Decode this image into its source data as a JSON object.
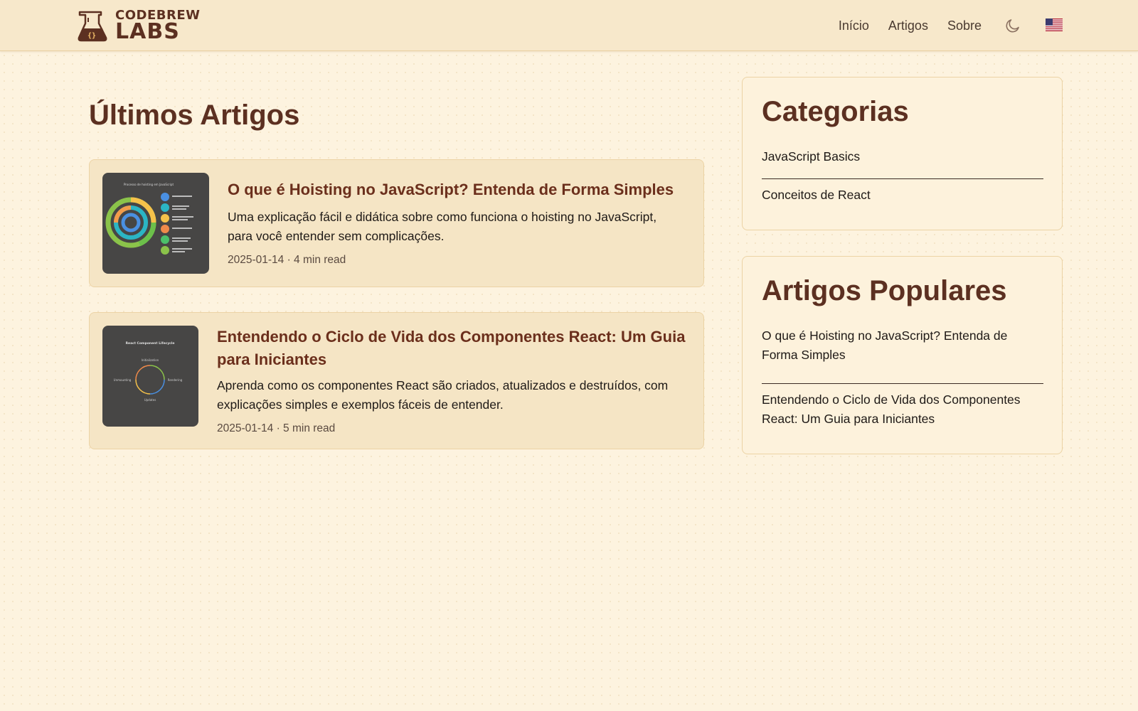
{
  "header": {
    "logo_top": "CODEBREW",
    "logo_bottom": "LABS",
    "nav": [
      "Início",
      "Artigos",
      "Sobre"
    ]
  },
  "main": {
    "title": "Últimos Artigos",
    "articles": [
      {
        "title": "O que é Hoisting no JavaScript? Entenda de Forma Simples",
        "description": "Uma explicação fácil e didática sobre como funciona o hoisting no JavaScript, para você entender sem complicações.",
        "meta": "2025-01-14 · 4 min read",
        "thumb_label": "Processo de hoisting em JavaScript"
      },
      {
        "title": "Entendendo o Ciclo de Vida dos Componentes React: Um Guia para Iniciantes",
        "description": "Aprenda como os componentes React são criados, atualizados e destruídos, com explicações simples e exemplos fáceis de entender.",
        "meta": "2025-01-14 · 5 min read",
        "thumb_label": "React Component Lifecycle",
        "thumb_stages": [
          "Initialization",
          "Rendering",
          "Updates",
          "Unmounting"
        ]
      }
    ]
  },
  "sidebar": {
    "categories_title": "Categorias",
    "categories": [
      "JavaScript Basics",
      "Conceitos de React"
    ],
    "popular_title": "Artigos Populares",
    "popular": [
      "O que é Hoisting no JavaScript? Entenda de Forma Simples",
      "Entendendo o Ciclo de Vida dos Componentes React: Um Guia para Iniciantes"
    ]
  },
  "colors": {
    "accent": "#5c3021",
    "card_bg": "#f5e5c5",
    "page_bg": "#fdf3df"
  },
  "icons": {
    "logo": "flask-icon",
    "theme": "moon-icon",
    "language": "us-flag-icon"
  }
}
